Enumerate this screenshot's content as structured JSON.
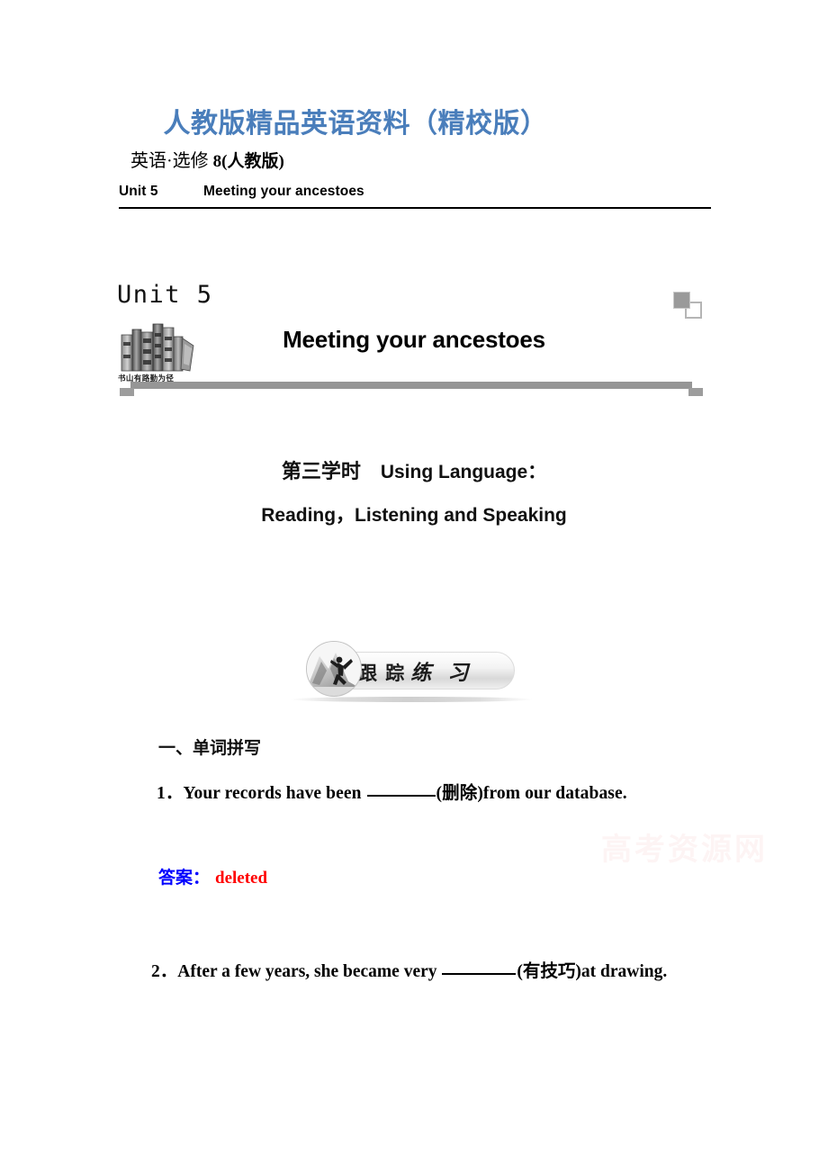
{
  "document": {
    "banner_title": "人教版精品英语资料（精校版）",
    "subject_line_cn": "英语·选修 ",
    "subject_line_vol": "8",
    "subject_line_pub": "(人教版)",
    "watermark": "高考资源网"
  },
  "running_head": {
    "unit": "Unit 5",
    "title": "Meeting your ancestoes"
  },
  "masthead": {
    "unit_number": "Unit 5",
    "unit_title": "Meeting your ancestoes",
    "book_motto": "书山有路勤为径"
  },
  "session": {
    "line1_cn": "第三学时",
    "line1_en": "Using Language：",
    "line2": "Reading，Listening and Speaking"
  },
  "badge": {
    "text_bold": "跟 踪",
    "text_brush": "练 习"
  },
  "exercises": {
    "section_heading": "一、单词拼写",
    "items": [
      {
        "number": "1．",
        "text_before": "Your records have been ",
        "hint": "(删除)",
        "text_after": "from our database."
      },
      {
        "number": "2．",
        "text_before": "After a few years, she became very ",
        "hint": "(有技巧)",
        "text_after": "at drawing."
      }
    ],
    "answers": [
      {
        "label": "答案：",
        "value": "deleted"
      }
    ]
  },
  "colors": {
    "banner_blue": "#4a7ebb",
    "answer_label_blue": "#0000ff",
    "answer_value_red": "#ff0000",
    "rule_gray": "#969696"
  }
}
